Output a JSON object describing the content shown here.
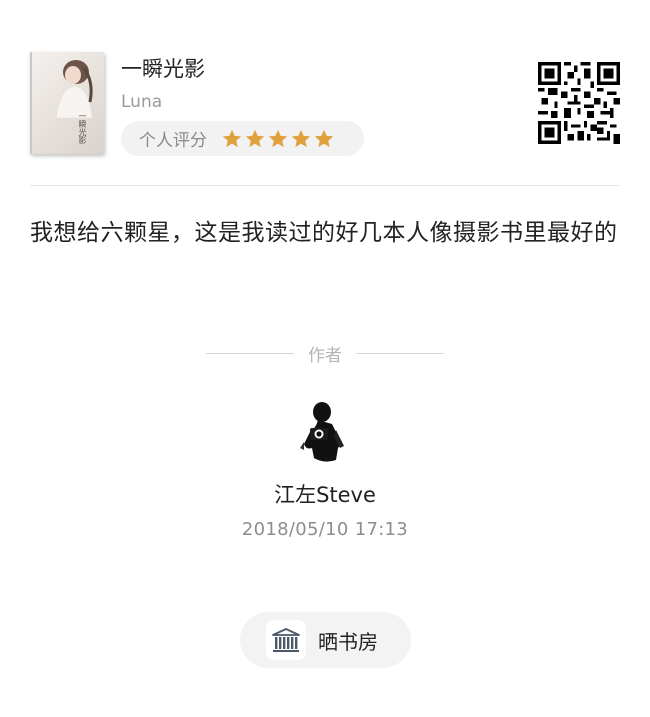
{
  "book": {
    "title": "一瞬光影",
    "author": "Luna",
    "cover_title": "一瞬光影",
    "rating_label": "个人评分",
    "rating_stars": 5,
    "star_color": "#E0A03C"
  },
  "review": {
    "text": "我想给六颗星，这是我读过的好几本人像摄影书里最好的"
  },
  "section": {
    "label": "作者"
  },
  "author": {
    "name": "江左Steve",
    "datetime": "2018/05/10  17:13"
  },
  "shelf_button": {
    "label": "晒书房"
  }
}
